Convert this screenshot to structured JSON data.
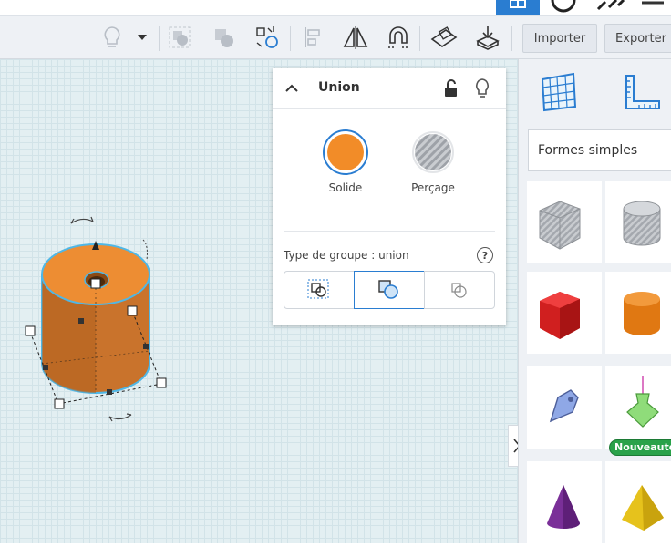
{
  "toolbar": {
    "import_label": "Importer",
    "export_label": "Exporter"
  },
  "inspector": {
    "title": "Union",
    "solid_label": "Solide",
    "hole_label": "Perçage",
    "group_type_label": "Type de groupe : union",
    "help_label": "?"
  },
  "shapes_panel": {
    "category_label": "Formes simples",
    "new_badge": "Nouveautés"
  },
  "colors": {
    "accent_blue": "#2a7dd1",
    "orange": "#f28c28",
    "workplane": "#e3eff2",
    "badge_green": "#2aa24a"
  }
}
